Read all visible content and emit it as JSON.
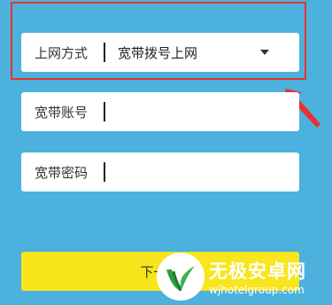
{
  "form": {
    "connection_type": {
      "label": "上网方式",
      "value": "宽带拨号上网"
    },
    "account": {
      "label": "宽带账号",
      "value": ""
    },
    "password": {
      "label": "宽带密码",
      "value": ""
    },
    "next_label": "下一步"
  },
  "annotation": {
    "highlight_color": "#e8312f"
  },
  "watermark": {
    "title": "无极安卓网",
    "url": "wjhotelgroup.com"
  },
  "colors": {
    "background": "#4cb1dd",
    "button": "#f8e51b"
  },
  "icons": {
    "dropdown": "chevron-down-icon",
    "logo": "green-leaf-logo"
  }
}
